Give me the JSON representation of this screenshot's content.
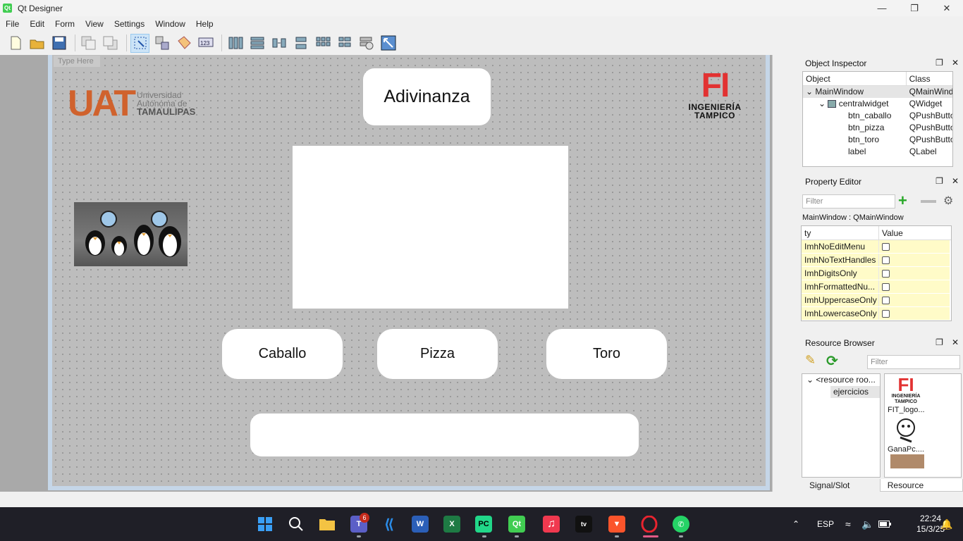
{
  "window": {
    "title": "Qt Designer",
    "app_icon": "Qt"
  },
  "menu": [
    "File",
    "Edit",
    "Form",
    "View",
    "Settings",
    "Window",
    "Help"
  ],
  "form": {
    "type_here": "Type Here",
    "title_label": "Adivinanza",
    "btn_caballo": "Caballo",
    "btn_pizza": "Pizza",
    "btn_toro": "Toro",
    "uat_logo": {
      "mark": "UAT",
      "line1": "Universidad",
      "line2": "Autónoma de",
      "line3": "TAMAULIPAS"
    },
    "fi_logo": {
      "mark": "FI",
      "line1": "INGENIERÍA",
      "line2": "TAMPICO"
    }
  },
  "object_inspector": {
    "title": "Object Inspector",
    "col_object": "Object",
    "col_class": "Class",
    "rows": [
      {
        "name": "MainWindow",
        "cls": "QMainWindo"
      },
      {
        "name": "centralwidget",
        "cls": "QWidget"
      },
      {
        "name": "btn_caballo",
        "cls": "QPushButto"
      },
      {
        "name": "btn_pizza",
        "cls": "QPushButto"
      },
      {
        "name": "btn_toro",
        "cls": "QPushButto"
      },
      {
        "name": "label",
        "cls": "QLabel"
      }
    ]
  },
  "property_editor": {
    "title": "Property Editor",
    "filter_placeholder": "Filter",
    "object_class": "MainWindow : QMainWindow",
    "col_property": "ty",
    "col_value": "Value",
    "rows": [
      {
        "name": "ImhNoEditMenu"
      },
      {
        "name": "ImhNoTextHandles"
      },
      {
        "name": "ImhDigitsOnly"
      },
      {
        "name": "ImhFormattedNu..."
      },
      {
        "name": "ImhUppercaseOnly"
      },
      {
        "name": "ImhLowercaseOnly"
      }
    ]
  },
  "resource_browser": {
    "title": "Resource Browser",
    "filter_placeholder": "Filter",
    "tree": [
      "<resource roo...",
      "ejercicios"
    ],
    "files": [
      "FIT_logo...",
      "GanaPc...."
    ],
    "thumb_fi": {
      "mark": "FI",
      "line1": "INGENIERÍA",
      "line2": "TAMPICO"
    }
  },
  "bottom_tabs": [
    "Signal/Slot Editor",
    "Resource Browser"
  ],
  "taskbar": {
    "teams_badge": "6",
    "lang": "ESP",
    "time": "22:24",
    "date": "15/3/25",
    "colors": {
      "bg": "#1f1f27",
      "accent": "#0078d4"
    }
  },
  "colors": {
    "form_bg": "#bdbdbd",
    "uat_orange": "#d0622d",
    "fi_red": "#e23232",
    "property_highlight": "#fffbc8"
  }
}
